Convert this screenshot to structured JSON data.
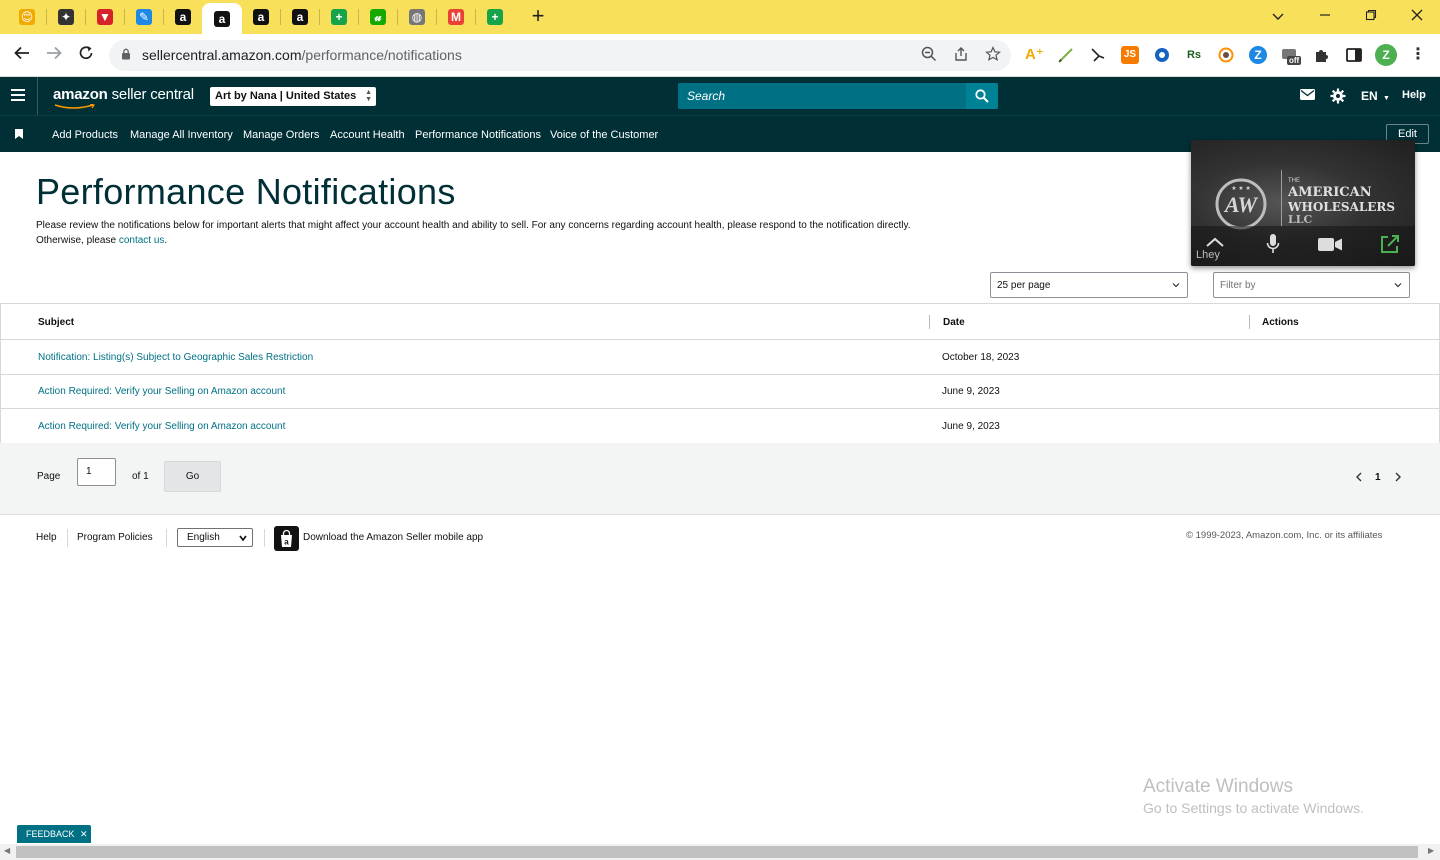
{
  "browser": {
    "tabs": [
      {
        "icon": "helper-icon",
        "color": "#f2a900",
        "glyph": "😊",
        "active": false
      },
      {
        "icon": "spy-icon",
        "color": "#333333",
        "glyph": "✦",
        "active": false
      },
      {
        "icon": "vpn-icon",
        "color": "#d6232a",
        "glyph": "▼",
        "active": false
      },
      {
        "icon": "pencil-icon",
        "color": "#1e88e5",
        "glyph": "✎",
        "active": false
      },
      {
        "icon": "amazon-icon",
        "color": "#111111",
        "glyph": "a",
        "active": false
      },
      {
        "icon": "amazon-icon",
        "color": "#111111",
        "glyph": "a",
        "active": true
      },
      {
        "icon": "amazon-icon",
        "color": "#111111",
        "glyph": "a",
        "active": false
      },
      {
        "icon": "amazon-icon",
        "color": "#111111",
        "glyph": "a",
        "active": false
      },
      {
        "icon": "sheets-icon",
        "color": "#16a34a",
        "glyph": "+",
        "active": false
      },
      {
        "icon": "upwork-icon",
        "color": "#14a800",
        "glyph": "𝓊",
        "active": false
      },
      {
        "icon": "globe-icon",
        "color": "#777777",
        "glyph": "◍",
        "active": false
      },
      {
        "icon": "gmail-icon",
        "color": "#ea4335",
        "glyph": "M",
        "active": false
      },
      {
        "icon": "sheets-icon",
        "color": "#16a34a",
        "glyph": "+",
        "active": false
      }
    ],
    "new_tab_label": "+",
    "url_host": "sellercentral.amazon.com",
    "url_path": "/performance/notifications",
    "profile_initial": "Z",
    "profile_color": "#4caf50",
    "extension_off_badge": "off",
    "extension_js_label": "JS",
    "extension_rs_label": "Rs"
  },
  "header": {
    "logo_text_1": "amazon",
    "logo_text_2": "seller central",
    "account": "Art by Nana | United States",
    "search_placeholder": "Search",
    "language": "EN",
    "help": "Help"
  },
  "nav": {
    "items": [
      "Add Products",
      "Manage All Inventory",
      "Manage Orders",
      "Account Health",
      "Performance Notifications",
      "Voice of the Customer"
    ],
    "edit_label": "Edit"
  },
  "main": {
    "title": "Performance Notifications",
    "intro_line1": "Please review the notifications below for important alerts that might affect your account health and ability to sell. For any concerns regarding account health, please respond to the notification directly.",
    "intro_line2_prefix": "Otherwise, please ",
    "intro_link": "contact us",
    "intro_line2_suffix": ".",
    "per_page": "25 per page",
    "filter_placeholder": "Filter by",
    "table": {
      "headers": {
        "subject": "Subject",
        "date": "Date",
        "actions": "Actions"
      },
      "rows": [
        {
          "subject": "Notification: Listing(s) Subject to Geographic Sales Restriction",
          "date": "October 18, 2023"
        },
        {
          "subject": "Action Required: Verify your Selling on Amazon account",
          "date": "June 9, 2023"
        },
        {
          "subject": "Action Required: Verify your Selling on Amazon account",
          "date": "June 9, 2023"
        }
      ]
    },
    "pager": {
      "page_label": "Page",
      "page_value": "1",
      "of_label": "of 1",
      "go_label": "Go",
      "current_page": "1"
    }
  },
  "footer": {
    "help": "Help",
    "program_policies": "Program Policies",
    "language": "English",
    "download_app": "Download the Amazon Seller mobile app",
    "copyright": "© 1999-2023, Amazon.com, Inc. or its affiliates"
  },
  "overlays": {
    "video_brand_small": "THE",
    "video_brand_line1": "AMERICAN",
    "video_brand_line2": "WHOLESALERS",
    "video_brand_line3": "LLC",
    "video_participant": "Lhey",
    "activate_title": "Activate Windows",
    "activate_subtitle": "Go to Settings to activate Windows.",
    "feedback_label": "FEEDBACK"
  },
  "colors": {
    "tabstrip": "#f9e05a",
    "header_bg": "#002f36",
    "link": "#007185",
    "search_bg": "#007185"
  }
}
